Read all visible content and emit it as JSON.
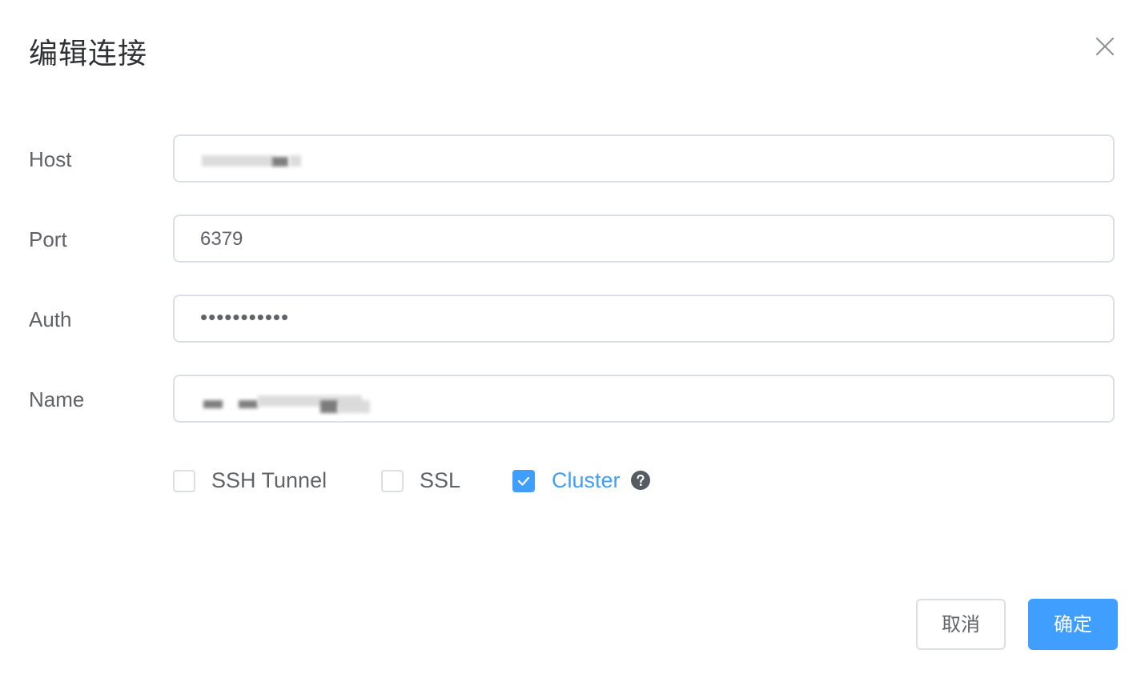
{
  "dialog": {
    "title": "编辑连接",
    "close_icon": "close-icon"
  },
  "form": {
    "host": {
      "label": "Host",
      "value": ""
    },
    "port": {
      "label": "Port",
      "value": "6379"
    },
    "auth": {
      "label": "Auth",
      "value": "•••••••••••"
    },
    "name": {
      "label": "Name",
      "value": ""
    }
  },
  "options": {
    "ssh_tunnel": {
      "label": "SSH Tunnel",
      "checked": false
    },
    "ssl": {
      "label": "SSL",
      "checked": false
    },
    "cluster": {
      "label": "Cluster",
      "checked": true,
      "help_icon": "question-circle-icon"
    }
  },
  "footer": {
    "cancel_label": "取消",
    "confirm_label": "确定"
  },
  "colors": {
    "accent": "#409eff",
    "border": "#dcdfe6",
    "text": "#606266",
    "title": "#303133"
  }
}
